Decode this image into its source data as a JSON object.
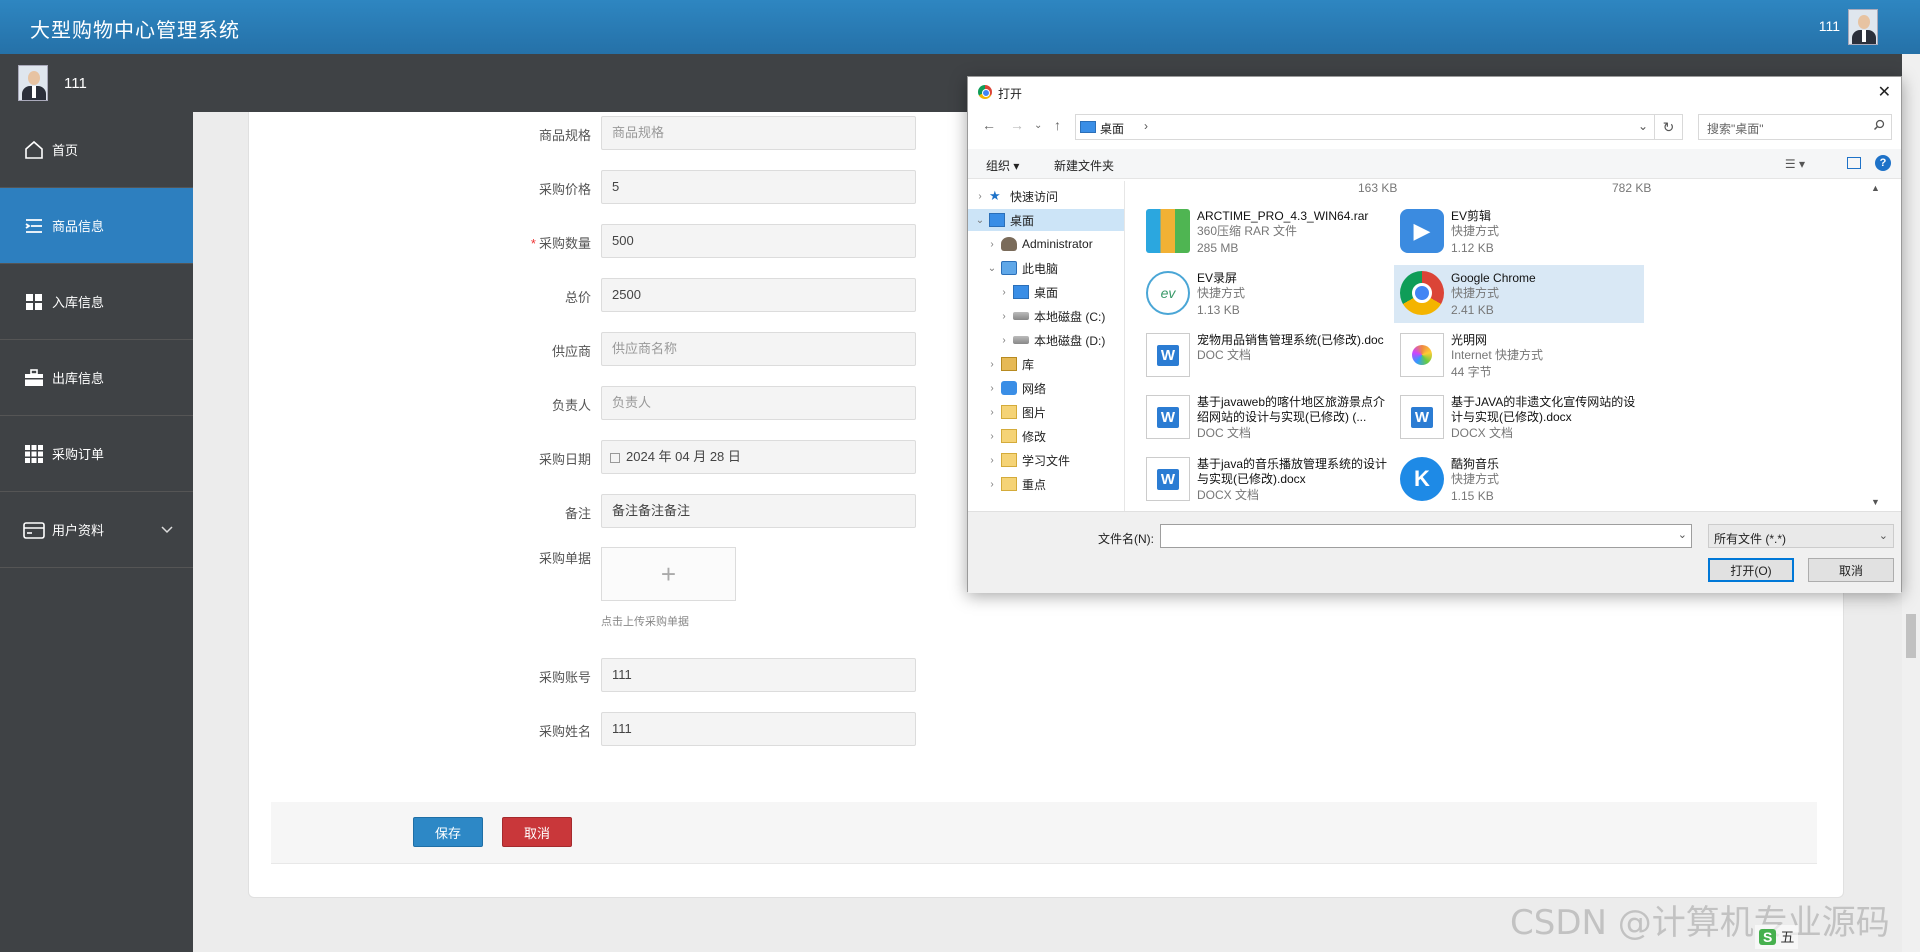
{
  "header": {
    "app_title": "大型购物中心管理系统",
    "user_name": "111"
  },
  "subbar": {
    "user_name": "111"
  },
  "sidebar": {
    "items": [
      {
        "label": "首页",
        "icon": "home-icon",
        "active": false
      },
      {
        "label": "商品信息",
        "icon": "list-icon",
        "active": true
      },
      {
        "label": "入库信息",
        "icon": "grid-icon",
        "active": false
      },
      {
        "label": "出库信息",
        "icon": "briefcase-icon",
        "active": false
      },
      {
        "label": "采购订单",
        "icon": "apps-icon",
        "active": false
      },
      {
        "label": "用户资料",
        "icon": "card-icon",
        "active": false
      }
    ]
  },
  "form": {
    "fields": [
      {
        "label": "商品规格",
        "value": "商品规格",
        "placeholder": true,
        "required": false
      },
      {
        "label": "采购价格",
        "value": "5",
        "placeholder": false,
        "required": false
      },
      {
        "label": "采购数量",
        "value": "500",
        "placeholder": false,
        "required": true
      },
      {
        "label": "总价",
        "value": "2500",
        "placeholder": false,
        "required": false
      },
      {
        "label": "供应商",
        "value": "供应商名称",
        "placeholder": true,
        "required": false
      },
      {
        "label": "负责人",
        "value": "负责人",
        "placeholder": true,
        "required": false
      },
      {
        "label": "采购日期",
        "value": "2024 年 04 月 28 日",
        "placeholder": false,
        "required": false
      },
      {
        "label": "备注",
        "value": "备注备注备注",
        "placeholder": false,
        "required": false
      }
    ],
    "upload_label": "采购单据",
    "upload_hint": "点击上传采购单据",
    "account_label": "采购账号",
    "account_value": "111",
    "name_label": "采购姓名",
    "name_value": "111",
    "save_label": "保存",
    "cancel_label": "取消"
  },
  "dialog": {
    "title": "打开",
    "path": "桌面",
    "search_placeholder": "搜索\"桌面\"",
    "toolbar": {
      "organize": "组织 ▾",
      "new_folder": "新建文件夹"
    },
    "tree": [
      {
        "label": "快速访问",
        "icon": "star",
        "indent": 0,
        "arrow": "›",
        "selected": false
      },
      {
        "label": "桌面",
        "icon": "desk",
        "indent": 0,
        "arrow": "⌄",
        "selected": true
      },
      {
        "label": "Administrator",
        "icon": "user",
        "indent": 1,
        "arrow": "›",
        "selected": false
      },
      {
        "label": "此电脑",
        "icon": "pc",
        "indent": 1,
        "arrow": "⌄",
        "selected": false
      },
      {
        "label": "桌面",
        "icon": "desk",
        "indent": 2,
        "arrow": "›",
        "selected": false
      },
      {
        "label": "本地磁盘 (C:)",
        "icon": "disk",
        "indent": 2,
        "arrow": "›",
        "selected": false
      },
      {
        "label": "本地磁盘 (D:)",
        "icon": "disk",
        "indent": 2,
        "arrow": "›",
        "selected": false
      },
      {
        "label": "库",
        "icon": "lib",
        "indent": 1,
        "arrow": "›",
        "selected": false
      },
      {
        "label": "网络",
        "icon": "net",
        "indent": 1,
        "arrow": "›",
        "selected": false
      },
      {
        "label": "图片",
        "icon": "folder",
        "indent": 1,
        "arrow": "›",
        "selected": false
      },
      {
        "label": "修改",
        "icon": "folder",
        "indent": 1,
        "arrow": "›",
        "selected": false
      },
      {
        "label": "学习文件",
        "icon": "folder",
        "indent": 1,
        "arrow": "›",
        "selected": false
      },
      {
        "label": "重点",
        "icon": "folder",
        "indent": 1,
        "arrow": "›",
        "selected": false
      }
    ],
    "top_sizes": [
      "163 KB",
      "782 KB"
    ],
    "files": [
      {
        "name": "ARCTIME_PRO_4.3_WIN64.rar",
        "type": "360压缩 RAR 文件",
        "size": "285 MB",
        "icon": "rar"
      },
      {
        "name": "EV剪辑",
        "type": "快捷方式",
        "size": "1.12 KB",
        "icon": "ev"
      },
      {
        "name": "EV录屏",
        "type": "快捷方式",
        "size": "1.13 KB",
        "icon": "evrec"
      },
      {
        "name": "Google Chrome",
        "type": "快捷方式",
        "size": "2.41 KB",
        "icon": "chrome",
        "highlight": true
      },
      {
        "name": "宠物用品销售管理系统(已修改).doc",
        "type": "DOC 文档",
        "size": "",
        "icon": "doc"
      },
      {
        "name": "光明网",
        "type": "Internet 快捷方式",
        "size": "44 字节",
        "icon": "web"
      },
      {
        "name": "基于javaweb的喀什地区旅游景点介绍网站的设计与实现(已修改) (...",
        "type": "DOC 文档",
        "size": "",
        "icon": "doc"
      },
      {
        "name": "基于JAVA的非遗文化宣传网站的设计与实现(已修改).docx",
        "type": "DOCX 文档",
        "size": "",
        "icon": "doc"
      },
      {
        "name": "基于java的音乐播放管理系统的设计与实现(已修改).docx",
        "type": "DOCX 文档",
        "size": "",
        "icon": "doc"
      },
      {
        "name": "酷狗音乐",
        "type": "快捷方式",
        "size": "1.15 KB",
        "icon": "kg"
      }
    ],
    "filename_label": "文件名(N):",
    "filename_value": "",
    "filetype": "所有文件 (*.*)",
    "open_label": "打开(O)",
    "cancel_label": "取消"
  },
  "watermark": "CSDN @计算机专业源码",
  "tray": {
    "ime": "S",
    "text": "五"
  }
}
